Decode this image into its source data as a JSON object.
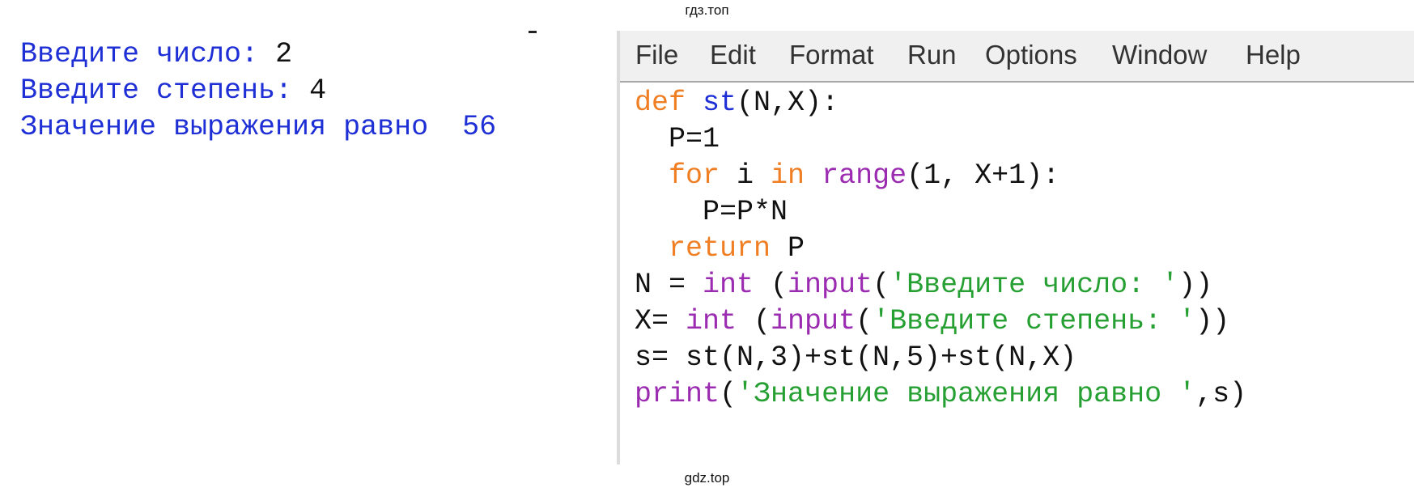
{
  "watermark": {
    "top": "гдз.топ",
    "bottom": "gdz.top"
  },
  "shell": {
    "lines": [
      {
        "prompt": "Введите число: ",
        "value": "2"
      },
      {
        "prompt": "Введите степень: ",
        "value": "4"
      },
      {
        "prompt": "Значение выражения равно  ",
        "value": "56"
      }
    ]
  },
  "menu": [
    "File",
    "Edit",
    "Format",
    "Run",
    "Options",
    "Window",
    "Help"
  ],
  "code": {
    "l1": {
      "kw": "def",
      "fn": "st",
      "rest": "(N,X):"
    },
    "l2": {
      "text": "  P=1"
    },
    "l3": {
      "for": "for",
      "i": " i ",
      "in": "in",
      "range": "range",
      "rest": "(1, X+1):"
    },
    "l4": {
      "text": "    P=P*N"
    },
    "l5": {
      "kw": "return",
      "rest": " P"
    },
    "l6": {
      "a": "N = ",
      "int": "int",
      "b": " (",
      "input": "input",
      "c": "(",
      "str": "'Введите число: '",
      "d": "))"
    },
    "l7": {
      "a": "X= ",
      "int": "int",
      "b": " (",
      "input": "input",
      "c": "(",
      "str": "'Введите степень: '",
      "d": "))"
    },
    "l8": {
      "text": "s= st(N,3)+st(N,5)+st(N,X)"
    },
    "l9": {
      "print": "print",
      "a": "(",
      "str": "'Значение выражения равно '",
      "b": ",s)"
    }
  }
}
